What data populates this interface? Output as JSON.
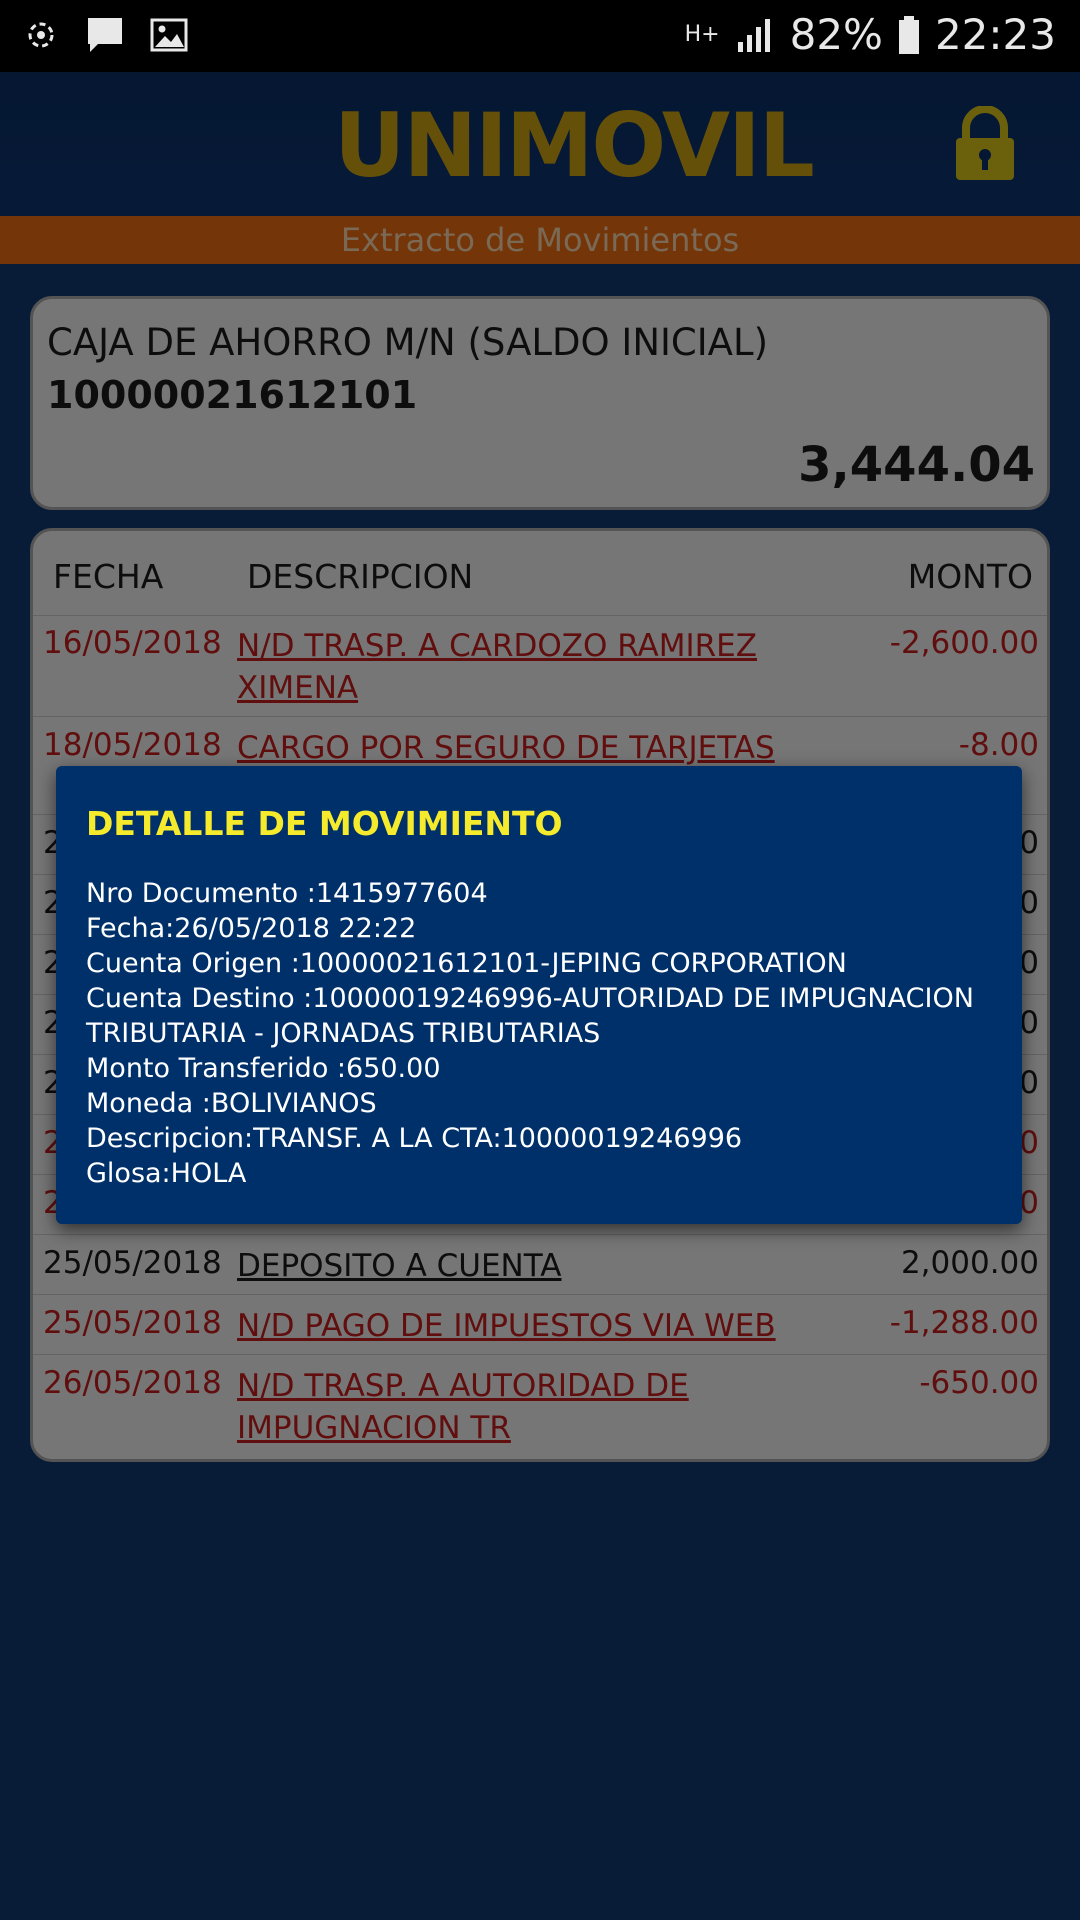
{
  "status_bar": {
    "icons_left": [
      "sync-icon",
      "chat-icon",
      "image-icon"
    ],
    "network": "H+",
    "battery": "82%",
    "time": "22:23"
  },
  "header": {
    "logo_text": "UNIMOVIL",
    "lock_icon": "lock-icon"
  },
  "subtitle": "Extracto de Movimientos",
  "account": {
    "name": "CAJA DE AHORRO M/N (SALDO INICIAL)",
    "number": "10000021612101",
    "balance": "3,444.04"
  },
  "table": {
    "columns": [
      "FECHA",
      "DESCRIPCION",
      "MONTO"
    ],
    "rows": [
      {
        "date": "16/05/2018",
        "desc": "N/D TRASP. A CARDOZO RAMIREZ XIMENA",
        "amount": "-2,600.00"
      },
      {
        "date": "18/05/2018",
        "desc": "CARGO POR SEGURO DE TARJETAS DE",
        "amount": "-8.00"
      },
      {
        "date": "2",
        "desc": "",
        "amount": "0"
      },
      {
        "date": "2",
        "desc": "",
        "amount": "0"
      },
      {
        "date": "2",
        "desc": "",
        "amount": "0"
      },
      {
        "date": "2",
        "desc": "",
        "amount": "0"
      },
      {
        "date": "2",
        "desc": "",
        "amount": "0"
      },
      {
        "date": "2",
        "desc": "",
        "amount": "0"
      },
      {
        "date": "2",
        "desc": "",
        "amount": "0"
      },
      {
        "date": "25/05/2018",
        "desc": "DEPOSITO A CUENTA",
        "amount": "2,000.00"
      },
      {
        "date": "25/05/2018",
        "desc": "N/D PAGO DE IMPUESTOS  VIA WEB",
        "amount": "-1,288.00"
      },
      {
        "date": "26/05/2018",
        "desc": "N/D TRASP. A AUTORIDAD DE IMPUGNACION TR",
        "amount": "-650.00"
      }
    ]
  },
  "dialog": {
    "title": "DETALLE DE MOVIMIENTO",
    "lines": [
      "Nro Documento :1415977604",
      "Fecha:26/05/2018 22:22",
      "Cuenta Origen :10000021612101-JEPING CORPORATION",
      "Cuenta Destino :10000019246996-AUTORIDAD DE IMPUGNACION",
      "TRIBUTARIA - JORNADAS TRIBUTARIAS",
      "Monto Transferido :650.00",
      "Moneda :BOLIVIANOS",
      "Descripcion:TRANSF. A LA CTA:10000019246996",
      "Glosa:HOLA"
    ]
  },
  "colors": {
    "background": "#11386f",
    "accent_orange": "#e86a12",
    "logo_gold": "#c8a013",
    "negative": "#c21d1d",
    "dialog_bg": "#00306a",
    "dialog_title": "#f5ea2c"
  }
}
